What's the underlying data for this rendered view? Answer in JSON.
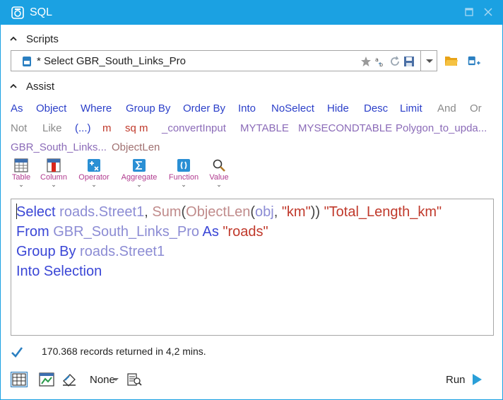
{
  "window": {
    "title": "SQL"
  },
  "colors": {
    "accent": "#1ba1e2",
    "keyword": "#3a46d6",
    "identifier": "#8c8cd4",
    "function": "#c08b8b",
    "string": "#c0392b"
  },
  "scripts": {
    "header": "Scripts",
    "current": "* Select GBR_South_Links_Pro"
  },
  "assist": {
    "header": "Assist",
    "row1": [
      "As",
      "Object",
      "Where",
      "Group By",
      "Order By",
      "Into",
      "NoSelect",
      "Hide",
      "Desc",
      "Limit",
      "And",
      "Or"
    ],
    "row2": [
      "Not",
      "Like",
      "(...)",
      "m",
      "sq m",
      "_convertInput",
      "MYTABLE",
      "MYSECONDTABLE",
      "Polygon_to_upda..."
    ],
    "row3": [
      "GBR_South_Links...",
      "ObjectLen"
    ]
  },
  "tools": [
    {
      "label": "Table",
      "icon": "table-icon"
    },
    {
      "label": "Column",
      "icon": "column-icon"
    },
    {
      "label": "Operator",
      "icon": "operator-icon"
    },
    {
      "label": "Aggregate",
      "icon": "sigma-icon"
    },
    {
      "label": "Function",
      "icon": "function-icon"
    },
    {
      "label": "Value",
      "icon": "magnifier-icon"
    }
  ],
  "editor": {
    "line1": {
      "kw1": "Select",
      "id1": "roads.Street1",
      "comma": ",",
      "fn1": "Sum",
      "p1": "(",
      "fn2": "ObjectLen",
      "p2": "(",
      "id2": "obj",
      "comma2": ",",
      "str1": "\"km\"",
      "p3": "))",
      "str2": "\"Total_Length_km\""
    },
    "line2": {
      "kw1": "From",
      "id1": "GBR_South_Links_Pro",
      "kw2": "As",
      "str1": "\"roads\""
    },
    "line3": {
      "kw1": "Group By",
      "id1": "roads.Street1"
    },
    "line4": {
      "kw1": "Into Selection"
    }
  },
  "status": {
    "text": "170.368 records returned in 4,2 mins."
  },
  "bottom": {
    "style_label": "None",
    "run_label": "Run"
  }
}
